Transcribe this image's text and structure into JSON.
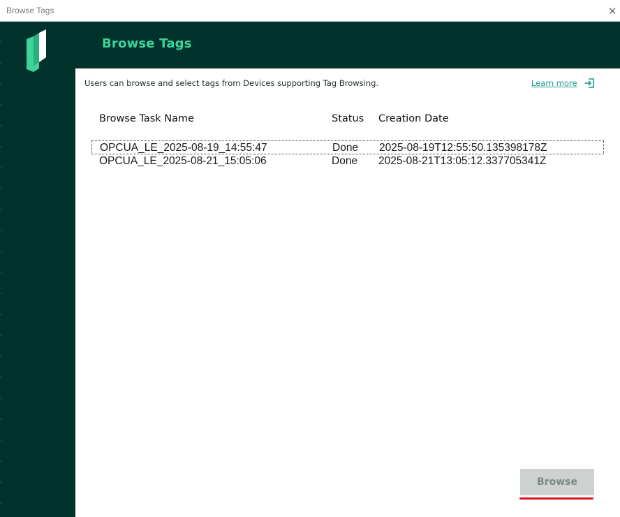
{
  "window": {
    "title": "Browse Tags",
    "close_glyph": "✕"
  },
  "header": {
    "title": "Browse Tags",
    "logo": "litmus-logo-icon"
  },
  "intro": {
    "description": "Users can browse and select tags from Devices supporting Tag Browsing.",
    "learn_more": "Learn more",
    "learn_more_icon": "open-external-icon"
  },
  "table": {
    "columns": [
      "Browse Task Name",
      "Status",
      "Creation Date"
    ],
    "rows": [
      {
        "name": "OPCUA_LE_2025-08-19_14:55:47",
        "status": "Done",
        "date": "2025-08-19T12:55:50.135398178Z",
        "selected": true
      },
      {
        "name": "OPCUA_LE_2025-08-21_15:05:06",
        "status": "Done",
        "date": "2025-08-21T13:05:12.337705341Z",
        "selected": false
      }
    ]
  },
  "actions": {
    "browse": "Browse",
    "browse_enabled": false
  },
  "colors": {
    "brand_dark": "#01322c",
    "brand_green": "#3ed399",
    "link": "#1a9a8f",
    "annotation_red": "#e0141b"
  }
}
